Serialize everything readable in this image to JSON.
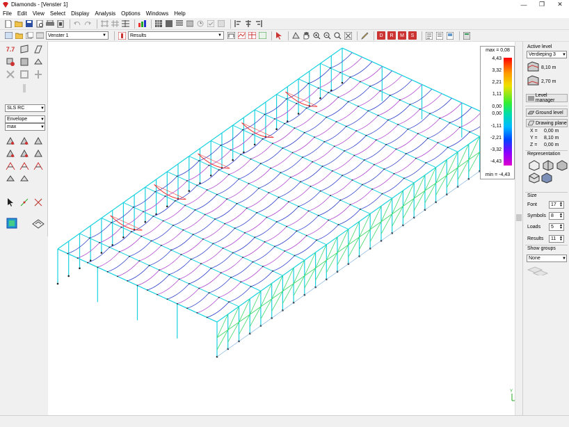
{
  "window": {
    "title": "Diamonds - [Venster 1]",
    "minimize_glyph": "—",
    "restore_glyph": "❐",
    "close_glyph": "✕"
  },
  "menu": [
    "File",
    "Edit",
    "View",
    "Select",
    "Display",
    "Analysis",
    "Options",
    "Windows",
    "Help"
  ],
  "toolbar2": {
    "window_select": "Venster 1",
    "results_select": "Results"
  },
  "left_panel": {
    "combo_load": "SLS RC",
    "combo_envelope": "Envelope",
    "combo_max": "max"
  },
  "legend": {
    "max_label": "max = 0,08",
    "min_label": "min = -4,43",
    "ticks": [
      "4,43",
      "3,32",
      "2,21",
      "1,11",
      "0,00",
      "0,00",
      "-1,11",
      "-2,21",
      "-3,32",
      "-4,43"
    ]
  },
  "right_panel": {
    "active_level_title": "Active level",
    "level_select": "Verdieping 3",
    "level_upper": "8,10 m",
    "level_lower": "2,70 m",
    "level_manager": "Level manager",
    "ground_level": "Ground level",
    "drawing_plane": "Drawing plane",
    "x_label": "X =",
    "x_value": "0,00 m",
    "y_label": "Y =",
    "y_value": "8,10 m",
    "z_label": "Z =",
    "z_value": "0,00 m",
    "representation_title": "Representation",
    "size_title": "Size",
    "font_label": "Font",
    "font_value": "17",
    "symbols_label": "Symbols",
    "symbols_value": "8",
    "loads_label": "Loads",
    "loads_value": "5",
    "results_label": "Results",
    "results_value": "11",
    "show_groups_title": "Show groups",
    "show_groups_value": "None"
  },
  "axis_glyph": {
    "y": "Y",
    "z": "Z"
  },
  "colors": {
    "frame_cyan": "#19d2e0",
    "truss_green": "#3fd96a",
    "purlin_blue": "#3344cc",
    "purlin_violet": "#b24bd1",
    "deflection_red": "#ee3333"
  }
}
